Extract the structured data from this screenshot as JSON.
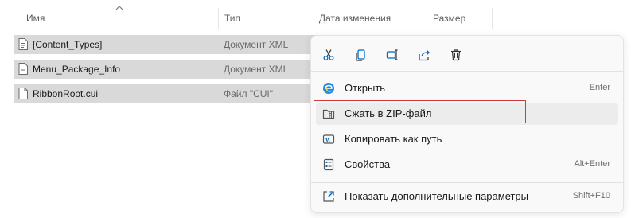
{
  "columns": {
    "name": "Имя",
    "type": "Тип",
    "date": "Дата изменения",
    "size": "Размер"
  },
  "files": [
    {
      "name": "[Content_Types]",
      "type": "Документ XML",
      "icon": "xml-file-icon"
    },
    {
      "name": "Menu_Package_Info",
      "type": "Документ XML",
      "icon": "xml-file-icon"
    },
    {
      "name": "RibbonRoot.cui",
      "type": "Файл \"CUI\"",
      "icon": "file-icon"
    }
  ],
  "context_menu": {
    "quick_actions": [
      "cut-icon",
      "copy-icon",
      "rename-icon",
      "share-icon",
      "delete-icon"
    ],
    "items": [
      {
        "label": "Открыть",
        "shortcut": "Enter",
        "icon": "edge-browser-icon"
      },
      {
        "label": "Сжать в ZIP-файл",
        "shortcut": "",
        "icon": "zip-folder-icon"
      },
      {
        "label": "Копировать как путь",
        "shortcut": "",
        "icon": "copy-path-icon"
      },
      {
        "label": "Свойства",
        "shortcut": "Alt+Enter",
        "icon": "properties-icon"
      },
      {
        "label": "Показать дополнительные параметры",
        "shortcut": "Shift+F10",
        "icon": "more-options-icon"
      }
    ]
  },
  "colors": {
    "accent": "#0067c0",
    "selection": "#d9d9d9",
    "highlight_box": "#d23b3b"
  }
}
